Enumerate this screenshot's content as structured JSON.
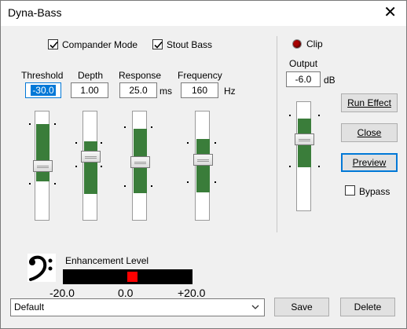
{
  "window": {
    "title": "Dyna-Bass",
    "close_glyph": "✕"
  },
  "checkboxes": {
    "compander": {
      "label": "Compander Mode",
      "checked": true
    },
    "stout_bass": {
      "label": "Stout Bass",
      "checked": true
    },
    "bypass": {
      "label": "Bypass",
      "checked": false
    }
  },
  "params": {
    "threshold": {
      "label": "Threshold",
      "value": "-30.0",
      "unit": ""
    },
    "depth": {
      "label": "Depth",
      "value": "1.00",
      "unit": ""
    },
    "response": {
      "label": "Response",
      "value": "25.0",
      "unit": "ms"
    },
    "frequency": {
      "label": "Frequency",
      "value": "160",
      "unit": "Hz"
    },
    "output": {
      "label": "Output",
      "value": "-6.0",
      "unit": "dB"
    }
  },
  "clip": {
    "label": "Clip"
  },
  "buttons": {
    "run_effect": "Run Effect",
    "close": "Close",
    "preview": "Preview",
    "save": "Save",
    "delete": "Delete"
  },
  "enhancement": {
    "label": "Enhancement Level",
    "scale_min": "-20.0",
    "scale_mid": "0.0",
    "scale_max": "+20.0",
    "icon": "bass-clef-icon"
  },
  "preset": {
    "selected": "Default"
  },
  "colors": {
    "accent": "#0078d7",
    "slider_fill": "#3a7d3a",
    "meter_mark": "#ff0000"
  }
}
